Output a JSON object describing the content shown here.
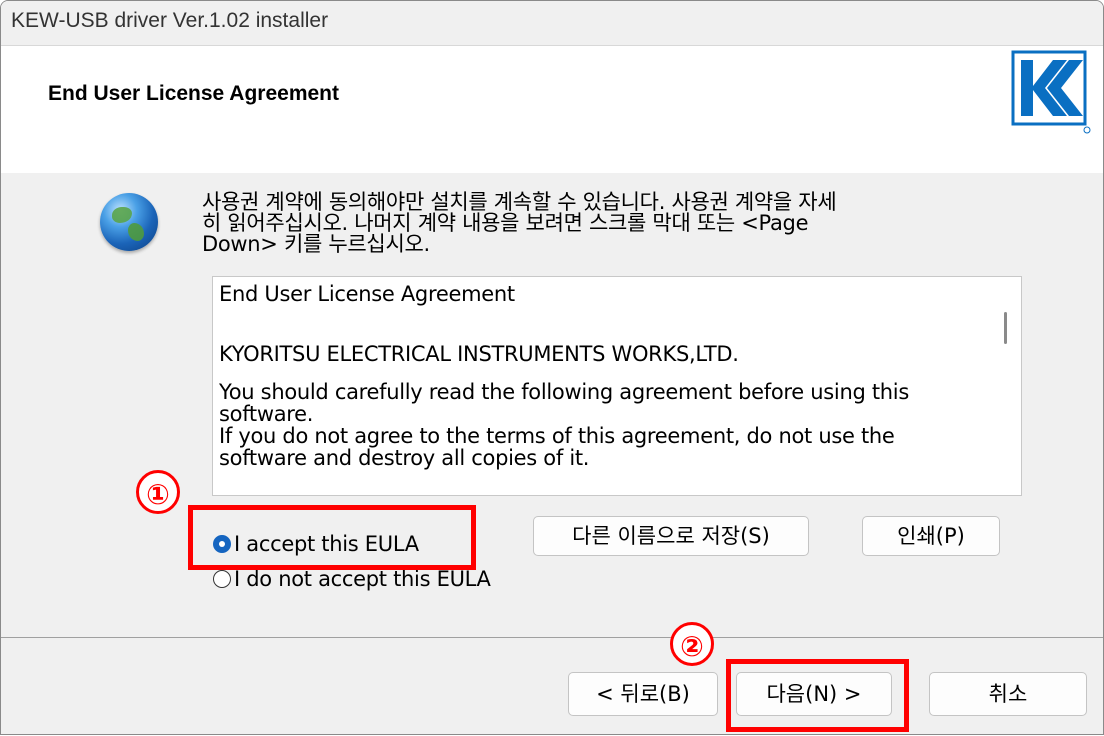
{
  "window": {
    "title": "KEW-USB driver Ver.1.02 installer"
  },
  "header": {
    "title": "End User License Agreement",
    "logo_icon": "kyoritsu-logo-icon"
  },
  "instructions": {
    "line1": "사용권 계약에 동의해야만 설치를 계속할 수 있습니다. 사용권 계약을 자세",
    "line2": "히 읽어주십시오. 나머지 계약 내용을 보려면 스크롤 막대 또는 <Page",
    "line3": "Down> 키를 누르십시오."
  },
  "eula": {
    "line1": "End User License Agreement",
    "line2": "KYORITSU ELECTRICAL INSTRUMENTS WORKS,LTD.",
    "line3": "You should carefully read the following agreement before using this",
    "line4": "software.",
    "line5": "If you do not agree to the terms of this agreement, do not use the",
    "line6": "software and destroy all copies of it."
  },
  "options": {
    "accept": "I accept this EULA",
    "decline": "I do not accept this EULA",
    "selected": "accept"
  },
  "buttons": {
    "save_as": "다른 이름으로 저장(S)",
    "print": "인쇄(P)",
    "back": "< 뒤로(B)",
    "next": "다음(N) >",
    "cancel": "취소"
  },
  "annotations": {
    "marker1": "①",
    "marker2": "②",
    "highlight_color": "#ff0000"
  },
  "colors": {
    "radio_selected": "#1565c0",
    "logo_blue": "#0a6fc2"
  }
}
